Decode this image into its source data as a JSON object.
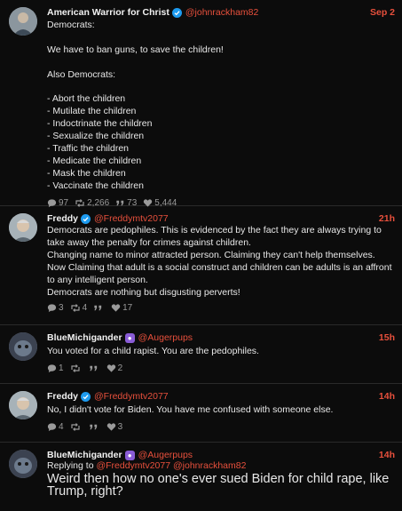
{
  "posts": [
    {
      "author": "American Warrior for Christ",
      "handle": "@johnrackham82",
      "time": "Sep 2",
      "badge": "verified",
      "text": "Democrats:\n\nWe have to ban guns, to save the children!\n\nAlso Democrats:\n\n- Abort the children\n- Mutilate the children\n- Indoctrinate the children\n- Sexualize the children\n- Traffic the children\n- Medicate the children\n- Mask the children\n- Vaccinate the children",
      "replies": "97",
      "reposts": "2,266",
      "quotes": "73",
      "likes": "5,444"
    },
    {
      "author": "Freddy",
      "handle": "@Freddymtv2077",
      "time": "21h",
      "badge": "verified",
      "text": "Democrats are pedophiles. This is evidenced by the fact they are always trying to take away the penalty for crimes against children.\nChanging name to minor attracted person. Claiming they can't help themselves.\nNow Claiming that adult is a social construct and children can be adults is an affront to any intelligent person.\nDemocrats are nothing but disgusting perverts!",
      "replies": "3",
      "reposts": "4",
      "quotes": "",
      "likes": "17"
    },
    {
      "author": "BlueMichigander",
      "handle": "@Augerpups",
      "time": "15h",
      "badge": "subscriber",
      "text": "You voted for a child rapist. You are the pedophiles.",
      "replies": "1",
      "reposts": "",
      "quotes": "",
      "likes": "2"
    },
    {
      "author": "Freddy",
      "handle": "@Freddymtv2077",
      "time": "14h",
      "badge": "verified",
      "text": "No, I didn't vote for Biden. You have me confused with someone else.",
      "replies": "4",
      "reposts": "",
      "quotes": "",
      "likes": "3"
    },
    {
      "author": "BlueMichigander",
      "handle": "@Augerpups",
      "time": "14h",
      "badge": "subscriber",
      "replying_label": "Replying to",
      "replying_to_1": "@Freddymtv2077",
      "replying_to_2": "@johnrackham82",
      "text": "Weird then how no one's ever sued Biden for child rape, like Trump, right?"
    }
  ],
  "colors": {
    "accent": "#e8503c",
    "verified": "#1d9bf0",
    "subscriber": "#8a5cd6",
    "background": "#0c0c0c"
  },
  "icons": [
    "reply-icon",
    "repost-icon",
    "quote-icon",
    "like-icon",
    "verified-icon",
    "subscriber-icon"
  ]
}
